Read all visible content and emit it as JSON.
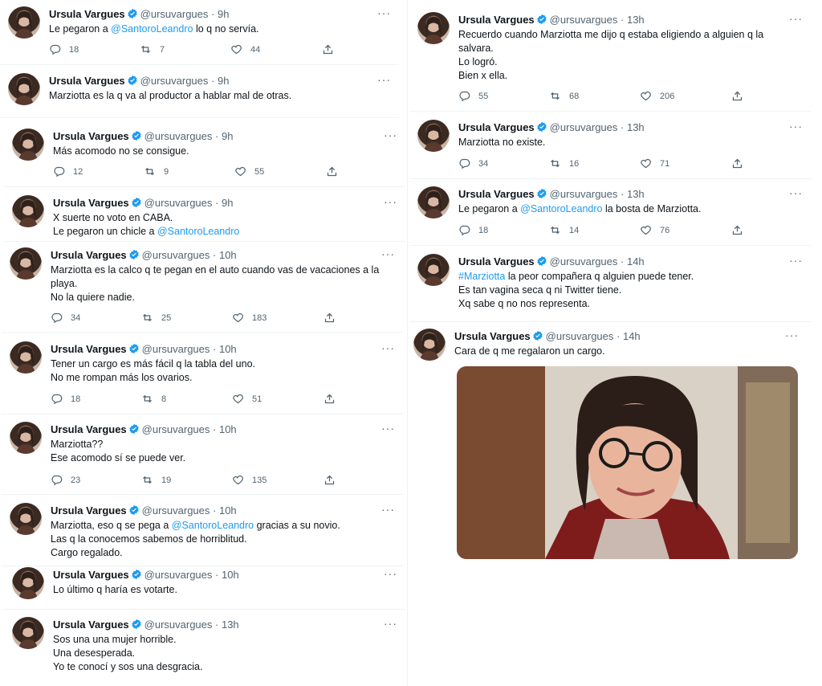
{
  "author": {
    "name": "Ursula Vargues",
    "handle": "@ursuvargues"
  },
  "colors": {
    "link": "#1d9bf0",
    "verified": "#1d9bf0",
    "muted": "#536471"
  },
  "tweets": [
    {
      "time": "· 9h",
      "lines": [
        "Le pegaron a @SantoroLeandro lo q no servía."
      ],
      "replies": "18",
      "retweets": "7",
      "likes": "44"
    },
    {
      "time": "· 9h",
      "lines": [
        "Marziotta es la q va al productor a hablar mal de otras."
      ]
    },
    {
      "time": "· 9h",
      "lines": [
        "Más acomodo no se consigue."
      ],
      "replies": "12",
      "retweets": "9",
      "likes": "55"
    },
    {
      "time": "· 9h",
      "lines": [
        "X suerte no voto en CABA.",
        "Le pegaron un chicle a @SantoroLeandro"
      ]
    },
    {
      "time": "· 10h",
      "lines": [
        "Marziotta es la calco q te pegan en el auto cuando vas de vacaciones a la",
        "playa.",
        "No la quiere nadie."
      ],
      "replies": "34",
      "retweets": "25",
      "likes": "183"
    },
    {
      "time": "· 10h",
      "lines": [
        "Tener un cargo es más fácil q la tabla del uno.",
        "No me rompan más los ovarios."
      ],
      "replies": "18",
      "retweets": "8",
      "likes": "51"
    },
    {
      "time": "· 10h",
      "lines": [
        "Marziotta??",
        "Ese acomodo sí se puede ver."
      ],
      "replies": "23",
      "retweets": "19",
      "likes": "135"
    },
    {
      "time": "· 10h",
      "lines": [
        "Marziotta, eso q se pega a @SantoroLeandro gracias a su novio.",
        "Las q la conocemos sabemos de horriblitud.",
        "Cargo regalado."
      ]
    },
    {
      "time": "· 10h",
      "lines": [
        "Lo último q haría es votarte."
      ]
    },
    {
      "time": "· 13h",
      "lines": [
        "Sos una una mujer horrible.",
        "Una desesperada.",
        "Yo te conocí y sos una desgracia."
      ]
    },
    {
      "time": "· 13h",
      "lines": [
        "Recuerdo cuando Marziotta me dijo q estaba eligiendo a alguien q la",
        "salvara.",
        "Lo logró.",
        "Bien x ella."
      ],
      "replies": "55",
      "retweets": "68",
      "likes": "206"
    },
    {
      "time": "· 13h",
      "lines": [
        "Marziotta no existe."
      ],
      "replies": "34",
      "retweets": "16",
      "likes": "71"
    },
    {
      "time": "· 13h",
      "lines": [
        "Le pegaron a @SantoroLeandro la bosta de Marziotta."
      ],
      "replies": "18",
      "retweets": "14",
      "likes": "76"
    },
    {
      "time": "· 14h",
      "lines": [
        "#Marziotta la peor compañera q alguien puede tener.",
        "Es tan vagina seca q ni Twitter tiene.",
        "Xq sabe q no nos representa."
      ]
    },
    {
      "time": "· 14h",
      "lines": [
        "Cara de q me regalaron un cargo."
      ]
    }
  ]
}
